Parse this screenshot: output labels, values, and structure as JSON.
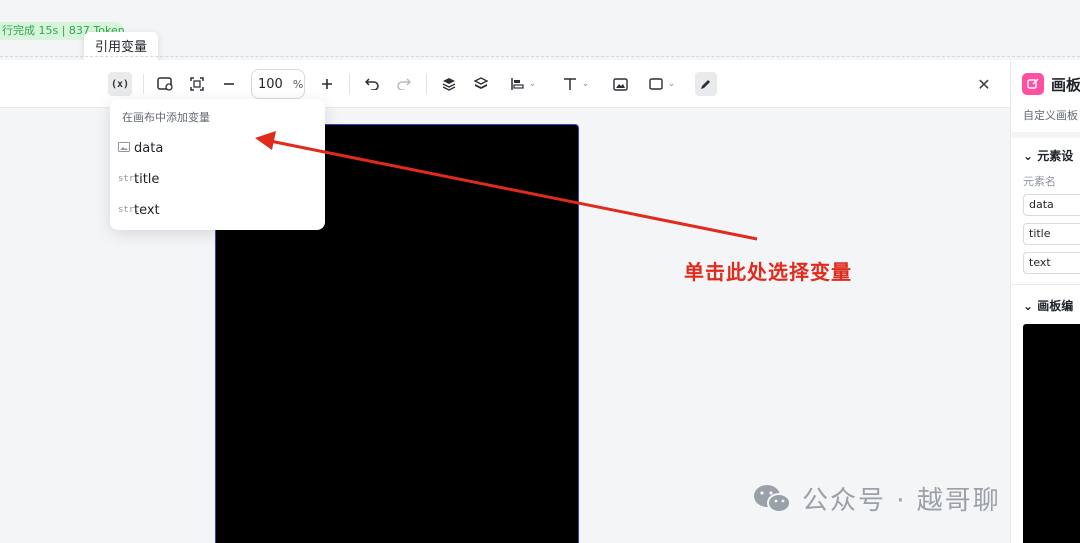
{
  "status": {
    "text": "行完成 15s | 837 Tokens"
  },
  "tooltip": {
    "text": "引用变量"
  },
  "toolbar": {
    "variable_icon": "(x)",
    "zoom_value": "100",
    "zoom_unit": "%",
    "icons": [
      "variable-icon",
      "canvas-size-icon",
      "fit-screen-icon",
      "zoom-out-icon",
      "zoom-in-icon",
      "undo-icon",
      "redo-icon",
      "layer-up-icon",
      "layer-down-icon",
      "align-icon",
      "text-icon",
      "image-icon",
      "shape-icon",
      "pen-icon",
      "close-icon"
    ]
  },
  "dropdown": {
    "heading": "在画布中添加变量",
    "items": [
      {
        "tag": "image-icon",
        "label": "data"
      },
      {
        "tag": "str.",
        "label": "title"
      },
      {
        "tag": "str.",
        "label": "text"
      }
    ]
  },
  "annotation": {
    "text": "单击此处选择变量",
    "color": "#e02b1c"
  },
  "right_panel": {
    "title": "画板",
    "description": "自定义画板",
    "section_elements": "元素设",
    "field_label": "元素名",
    "fields": [
      "data",
      "title",
      "text"
    ],
    "section_canvas": "画板编"
  },
  "watermark": {
    "text": "公众号 · 越哥聊"
  },
  "colors": {
    "accent_pink": "#ff4fa3",
    "status_green": "#2fa84f",
    "annotation_red": "#e02b1c",
    "canvas_border": "#3a3fc0"
  }
}
